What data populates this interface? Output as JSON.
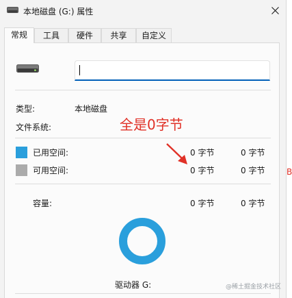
{
  "window": {
    "title": "本地磁盘 (G:) 属性",
    "close_icon": "close-icon"
  },
  "tabs": [
    {
      "label": "常规",
      "active": true
    },
    {
      "label": "工具",
      "active": false
    },
    {
      "label": "硬件",
      "active": false
    },
    {
      "label": "共享",
      "active": false
    },
    {
      "label": "自定义",
      "active": false
    }
  ],
  "general": {
    "drive_icon": "drive-icon",
    "name_value": "",
    "type_label": "类型:",
    "type_value": "本地磁盘",
    "filesystem_label": "文件系统:",
    "filesystem_value": "",
    "used_label": "已用空间:",
    "used_bytes": "0 字节",
    "used_size": "0 字节",
    "free_label": "可用空间:",
    "free_bytes": "0 字节",
    "free_size": "0 字节",
    "capacity_label": "容量:",
    "capacity_bytes": "0 字节",
    "capacity_size": "0 字节",
    "drive_label": "驱动器 G:"
  },
  "colors": {
    "used": "#2a9fdc",
    "free": "#ababab",
    "accent": "#005fb8",
    "annotation": "#e03127"
  },
  "annotation": {
    "text": "全是0字节",
    "arrow_icon": "arrow-icon"
  },
  "edge_letter": "B",
  "watermark": "@稀土掘金技术社区"
}
